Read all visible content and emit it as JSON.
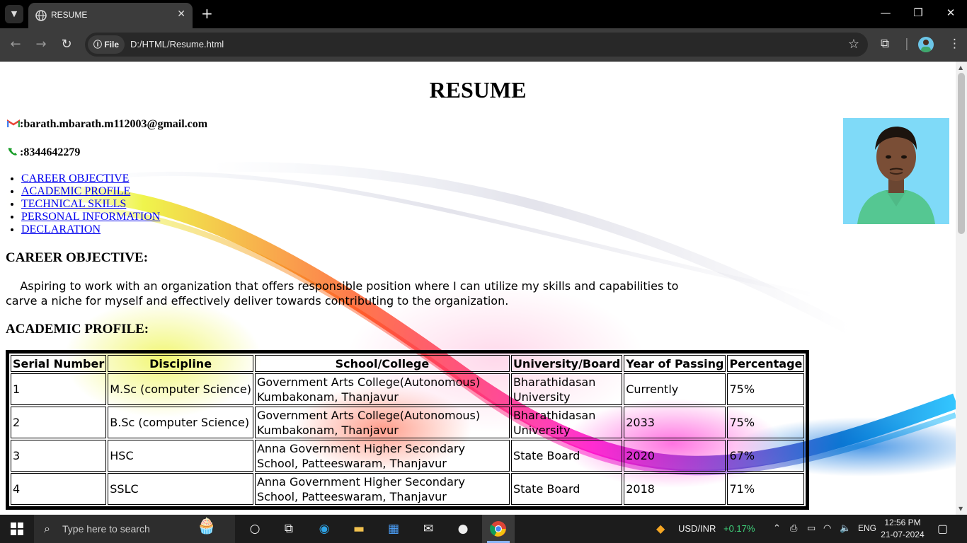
{
  "browser": {
    "tab_title": "RESUME",
    "tab_close": "✕",
    "new_tab": "+",
    "url_chip": "File",
    "url": "D:/HTML/Resume.html",
    "window_controls": [
      "minimize-icon",
      "restore-icon",
      "close-icon"
    ]
  },
  "page": {
    "title": "RESUME",
    "email": ":barath.mbarath.m112003@gmail.com",
    "phone": ":8344642279",
    "nav_links": [
      "CAREER OBJECTIVE",
      "ACADEMIC PROFILE",
      "TECHNICAL SKILLS",
      "PERSONAL INFORMATION",
      "DECLARATION"
    ],
    "career_heading": "CAREER OBJECTIVE:",
    "career_text": "Aspiring to work with an organization that offers responsible position where I can utilize my skills and capabilities to carve a niche for myself and effectively deliver towards contributing to the organization.",
    "academic_heading": "ACADEMIC PROFILE:",
    "table": {
      "headers": [
        "Serial Number",
        "Discipline",
        "School/College",
        "University/Board",
        "Year of Passing",
        "Percentage"
      ],
      "rows": [
        [
          "1",
          "M.Sc (computer Science)",
          "Government Arts College(Autonomous) Kumbakonam, Thanjavur",
          "Bharathidasan University",
          "Currently",
          "75%"
        ],
        [
          "2",
          "B.Sc (computer Science)",
          "Government Arts College(Autonomous) Kumbakonam, Thanjavur",
          "Bharathidasan University",
          "2033",
          "75%"
        ],
        [
          "3",
          "HSC",
          "Anna Government Higher Secondary School, Patteeswaram, Thanjavur",
          "State Board",
          "2020",
          "67%"
        ],
        [
          "4",
          "SSLC",
          "Anna Government Higher Secondary School, Patteeswaram, Thanjavur",
          "State Board",
          "2018",
          "71%"
        ]
      ]
    }
  },
  "taskbar": {
    "search_placeholder": "Type here to search",
    "ticker": "USD/INR",
    "ticker_change": "+0.17%",
    "language": "ENG",
    "time": "12:56 PM",
    "date": "21-07-2024"
  },
  "colors": {
    "link": "#0000ee",
    "chrome_dark": "#3c3c3c",
    "ticker_green": "#3fd17a"
  }
}
